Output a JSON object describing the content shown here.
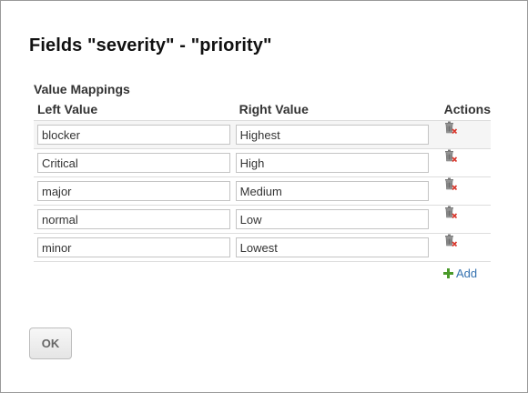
{
  "dialog": {
    "title": "Fields \"severity\" - \"priority\"",
    "section_title": "Value Mappings",
    "ok_label": "OK"
  },
  "table": {
    "columns": {
      "left": "Left Value",
      "right": "Right Value",
      "actions": "Actions"
    },
    "rows": [
      {
        "left": "blocker",
        "right": "Highest"
      },
      {
        "left": "Critical",
        "right": "High"
      },
      {
        "left": "major",
        "right": "Medium"
      },
      {
        "left": "normal",
        "right": "Low"
      },
      {
        "left": "minor",
        "right": "Lowest"
      }
    ],
    "row_action_icon": "trash-delete-icon",
    "add_label": "Add",
    "add_icon": "plus-icon"
  },
  "colors": {
    "link": "#3572b0",
    "plus": "#4a9a2a",
    "delete_x": "#d9362b"
  }
}
